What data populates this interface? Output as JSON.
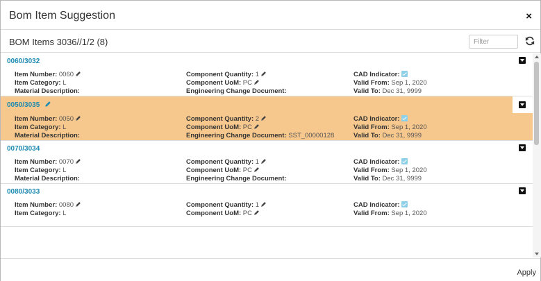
{
  "dialog": {
    "title": "Bom Item Suggestion",
    "close_label": "×"
  },
  "subheader": {
    "title": "BOM Items 3036//1/2 (8)",
    "filter_placeholder": "Filter"
  },
  "labels": {
    "item_number": "Item Number:",
    "item_category": "Item Category:",
    "material_description": "Material Description:",
    "component_quantity": "Component Quantity:",
    "component_uom": "Component UoM:",
    "engineering_change_document": "Engineering Change Document:",
    "cad_indicator": "CAD Indicator:",
    "valid_from": "Valid From:",
    "valid_to": "Valid To:"
  },
  "items": [
    {
      "id": "0060/3032",
      "item_number": "0060",
      "item_category": "L",
      "material_description": "",
      "component_quantity": "1",
      "component_uom": "PC",
      "engineering_change_document": "",
      "cad_indicator": true,
      "valid_from": "Sep 1, 2020",
      "valid_to": "Dec 31, 9999",
      "selected": false
    },
    {
      "id": "0050/3035",
      "item_number": "0050",
      "item_category": "L",
      "material_description": "",
      "component_quantity": "2",
      "component_uom": "PC",
      "engineering_change_document": "SST_00000128",
      "cad_indicator": true,
      "valid_from": "Sep 1, 2020",
      "valid_to": "Dec 31, 9999",
      "selected": true
    },
    {
      "id": "0070/3034",
      "item_number": "0070",
      "item_category": "L",
      "material_description": "",
      "component_quantity": "1",
      "component_uom": "PC",
      "engineering_change_document": "",
      "cad_indicator": true,
      "valid_from": "Sep 1, 2020",
      "valid_to": "Dec 31, 9999",
      "selected": false
    },
    {
      "id": "0080/3033",
      "item_number": "0080",
      "item_category": "L",
      "component_quantity": "1",
      "component_uom": "PC",
      "cad_indicator": true,
      "valid_from": "Sep 1, 2020",
      "selected": false
    }
  ],
  "footer": {
    "apply_label": "Apply"
  },
  "colors": {
    "link": "#1d8ab0",
    "selected_row": "#f7c88d",
    "checkbox": "#8dd0e8"
  },
  "icons": {
    "close": "close-icon",
    "refresh": "refresh-icon",
    "edit": "pencil-icon",
    "expand": "caret-down-icon"
  }
}
